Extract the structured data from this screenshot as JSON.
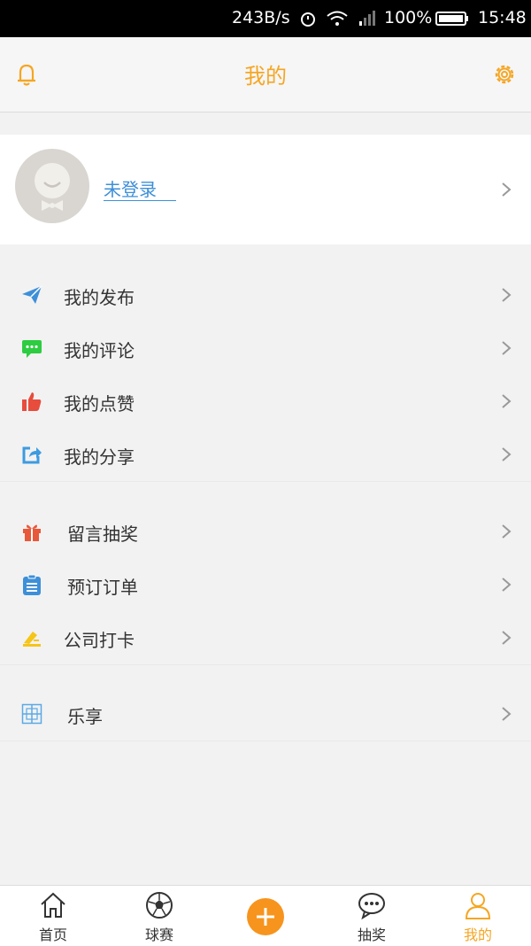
{
  "status_bar": {
    "speed": "243B/s",
    "battery": "100%",
    "time": "15:48"
  },
  "header": {
    "title": "我的"
  },
  "profile": {
    "login_label": "未登录"
  },
  "menu": {
    "group1": [
      {
        "label": "我的发布",
        "icon": "paper-plane-icon",
        "color": "#3d8fd8"
      },
      {
        "label": "我的评论",
        "icon": "comment-icon",
        "color": "#2ecc40"
      },
      {
        "label": "我的点赞",
        "icon": "thumbs-up-icon",
        "color": "#e74c3c"
      },
      {
        "label": "我的分享",
        "icon": "share-icon",
        "color": "#3d9be0"
      }
    ],
    "group2": [
      {
        "label": "留言抽奖",
        "icon": "gift-icon",
        "color": "#e8583a"
      },
      {
        "label": "预订订单",
        "icon": "clipboard-icon",
        "color": "#3d8fd8"
      },
      {
        "label": "公司打卡",
        "icon": "checkin-icon",
        "color": "#f5c518"
      }
    ],
    "group3": [
      {
        "label": "乐享",
        "icon": "grid-icon",
        "color": "#5aa9e6"
      }
    ]
  },
  "tabbar": {
    "tabs": [
      {
        "label": "首页",
        "icon": "home-icon"
      },
      {
        "label": "球赛",
        "icon": "soccer-ball-icon"
      },
      {
        "label": "",
        "icon": "plus-icon"
      },
      {
        "label": "抽奖",
        "icon": "chat-bubble-icon"
      },
      {
        "label": "我的",
        "icon": "user-icon"
      }
    ],
    "active": "我的"
  },
  "colors": {
    "accent": "#f5a623",
    "link": "#3d8fd8"
  }
}
